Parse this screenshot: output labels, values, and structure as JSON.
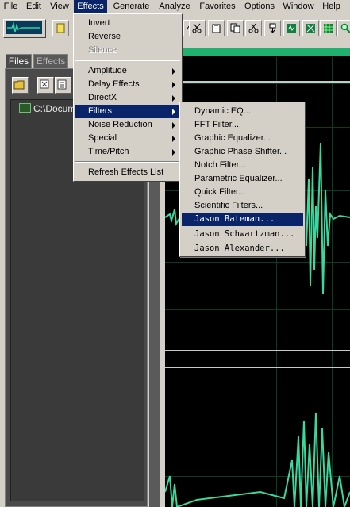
{
  "menubar": {
    "items": [
      "File",
      "Edit",
      "View",
      "Effects",
      "Generate",
      "Analyze",
      "Favorites",
      "Options",
      "Window",
      "Help"
    ],
    "active": "Effects"
  },
  "left_panel": {
    "tabs": [
      "Files",
      "Effects"
    ],
    "active_tab": "Files",
    "file_entry": "C:\\Documen"
  },
  "effects_menu": {
    "items": [
      {
        "label": "Invert",
        "submenu": false,
        "enabled": true
      },
      {
        "label": "Reverse",
        "submenu": false,
        "enabled": true
      },
      {
        "label": "Silence",
        "submenu": false,
        "enabled": false
      },
      {
        "label": "Amplitude",
        "submenu": true,
        "enabled": true
      },
      {
        "label": "Delay Effects",
        "submenu": true,
        "enabled": true
      },
      {
        "label": "DirectX",
        "submenu": true,
        "enabled": true
      },
      {
        "label": "Filters",
        "submenu": true,
        "enabled": true,
        "highlighted": true
      },
      {
        "label": "Noise Reduction",
        "submenu": true,
        "enabled": true
      },
      {
        "label": "Special",
        "submenu": true,
        "enabled": true
      },
      {
        "label": "Time/Pitch",
        "submenu": true,
        "enabled": true
      },
      {
        "label": "Refresh Effects List",
        "submenu": false,
        "enabled": true
      }
    ]
  },
  "filters_menu": {
    "items": [
      {
        "label": "Dynamic EQ..."
      },
      {
        "label": "FFT Filter..."
      },
      {
        "label": "Graphic Equalizer..."
      },
      {
        "label": "Graphic Phase Shifter..."
      },
      {
        "label": "Notch Filter..."
      },
      {
        "label": "Parametric Equalizer..."
      },
      {
        "label": "Quick Filter..."
      },
      {
        "label": "Scientific Filters..."
      },
      {
        "label": "Jason Bateman...",
        "highlighted": true
      },
      {
        "label": "Jason Schwartzman..."
      },
      {
        "label": "Jason Alexander..."
      }
    ]
  },
  "colors": {
    "menu_highlight": "#0a246a",
    "waveform": "#38d8a0",
    "panel_dark": "#4a4a4a"
  }
}
